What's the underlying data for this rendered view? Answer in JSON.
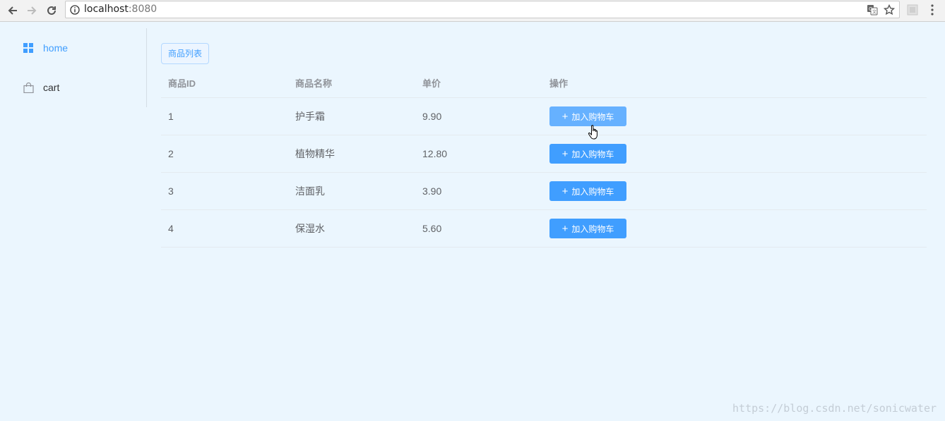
{
  "browser": {
    "url_host": "localhost",
    "url_port": ":8080",
    "icons": [
      "back-icon",
      "forward-icon",
      "reload-icon",
      "info-icon",
      "translate-icon",
      "star-icon",
      "extension-icon",
      "menu-icon"
    ]
  },
  "sidebar": {
    "items": [
      {
        "label": "home",
        "icon": "grid-icon",
        "active": true
      },
      {
        "label": "cart",
        "icon": "bag-icon",
        "active": false
      }
    ]
  },
  "main": {
    "tag_label": "商品列表",
    "table": {
      "headers": [
        "商品ID",
        "商品名称",
        "单价",
        "操作"
      ],
      "rows": [
        {
          "id": "1",
          "name": "护手霜",
          "price": "9.90",
          "action": "加入购物车"
        },
        {
          "id": "2",
          "name": "植物精华",
          "price": "12.80",
          "action": "加入购物车"
        },
        {
          "id": "3",
          "name": "洁面乳",
          "price": "3.90",
          "action": "加入购物车"
        },
        {
          "id": "4",
          "name": "保湿水",
          "price": "5.60",
          "action": "加入购物车"
        }
      ]
    }
  },
  "watermark": "https://blog.csdn.net/sonicwater",
  "colors": {
    "accent": "#409eff",
    "accent_hover": "#66b1ff",
    "background": "#ebf6fe"
  }
}
